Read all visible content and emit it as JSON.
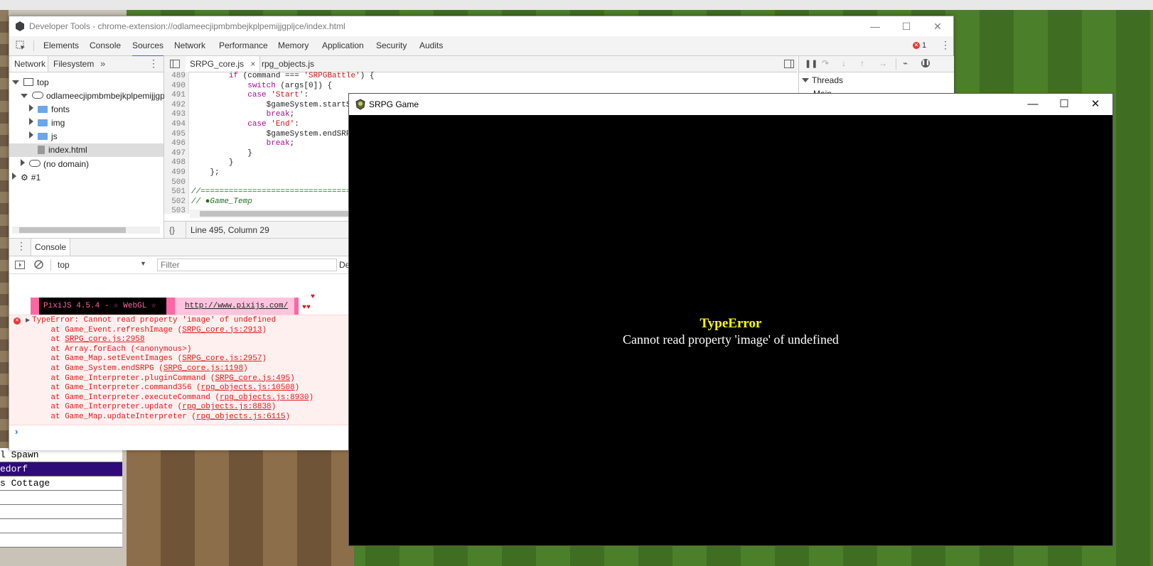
{
  "background": {
    "map_list": [
      "l Spawn",
      "edorf",
      "s Cottage"
    ]
  },
  "devtools": {
    "title": "Developer Tools - chrome-extension://odlameecjipmbmbejkplpemijjgpljce/index.html",
    "tabs": [
      "Elements",
      "Console",
      "Sources",
      "Network",
      "Performance",
      "Memory",
      "Application",
      "Security",
      "Audits"
    ],
    "active_tab": "Sources",
    "error_count": "1",
    "navigator": {
      "tabs": [
        "Network",
        "Filesystem"
      ],
      "more": "»",
      "tree": {
        "top": "top",
        "extension": "odlameecjipmbmbejkplpemijjgplj",
        "fonts": "fonts",
        "img": "img",
        "js": "js",
        "index": "index.html",
        "no_domain": "(no domain)",
        "worker": "#1"
      }
    },
    "editor": {
      "files": [
        "SRPG_core.js",
        "rpg_objects.js"
      ],
      "close": "×",
      "line_numbers": [
        "489",
        "490",
        "491",
        "492",
        "493",
        "494",
        "495",
        "496",
        "497",
        "498",
        "499",
        "500",
        "501",
        "502",
        "503"
      ],
      "status": "Line 495, Column 29",
      "braces": "{}"
    },
    "debugger": {
      "threads_label": "Threads",
      "main_label": "Main"
    },
    "console": {
      "tab": "Console",
      "context": "top",
      "filter_placeholder": "Filter",
      "default_levels": "De",
      "pixi_label": "PixiJS 4.5.4 - ☆ WebGL ☆",
      "pixi_url": "http://www.pixijs.com/",
      "error_head": "TypeError: Cannot read property 'image' of undefined",
      "stack": [
        {
          "fn": "    at Game_Event.refreshImage (",
          "loc": "SRPG_core.js:2913",
          "end": ")"
        },
        {
          "fn": "    at ",
          "loc": "SRPG_core.js:2958",
          "end": ""
        },
        {
          "fn": "    at Array.forEach (<anonymous>)",
          "loc": "",
          "end": ""
        },
        {
          "fn": "    at Game_Map.setEventImages (",
          "loc": "SRPG_core.js:2957",
          "end": ")"
        },
        {
          "fn": "    at Game_System.endSRPG (",
          "loc": "SRPG_core.js:1198",
          "end": ")"
        },
        {
          "fn": "    at Game_Interpreter.pluginCommand (",
          "loc": "SRPG_core.js:495",
          "end": ")"
        },
        {
          "fn": "    at Game_Interpreter.command356 (",
          "loc": "rpg_objects.js:10508",
          "end": ")"
        },
        {
          "fn": "    at Game_Interpreter.executeCommand (",
          "loc": "rpg_objects.js:8930",
          "end": ")"
        },
        {
          "fn": "    at Game_Interpreter.update (",
          "loc": "rpg_objects.js:8838",
          "end": ")"
        },
        {
          "fn": "    at Game_Map.updateInterpreter (",
          "loc": "rpg_objects.js:6115",
          "end": ")"
        }
      ],
      "prompt": "›"
    }
  },
  "game": {
    "title": "SRPG Game",
    "error_title": "TypeError",
    "error_message": "Cannot read property 'image' of undefined"
  }
}
